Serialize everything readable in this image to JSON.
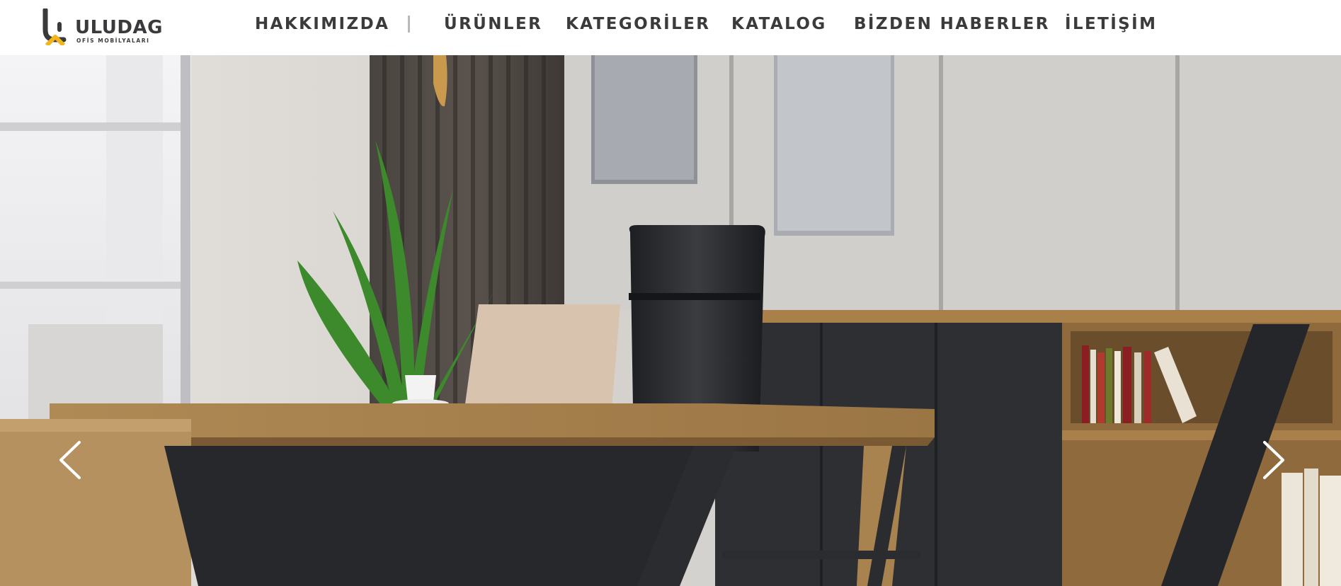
{
  "brand": {
    "name": "ULUDAG",
    "tagline": "OFİS MOBİLYALARI",
    "accent_color": "#f2b51c",
    "dark_color": "#3a3a3c"
  },
  "nav": {
    "items": [
      {
        "label": "HAKKIMIZDA"
      },
      {
        "label": "ÜRÜNLER"
      },
      {
        "label": "KATEGORİLER"
      },
      {
        "label": "KATALOG"
      },
      {
        "label": "BİZDEN HABERLER"
      },
      {
        "label": "İLETİŞİM"
      }
    ],
    "separator_icon": "vertical-bar"
  },
  "hero": {
    "image_subject": "office-desk-scene",
    "prev_icon": "chevron-left-icon",
    "next_icon": "chevron-right-icon"
  }
}
